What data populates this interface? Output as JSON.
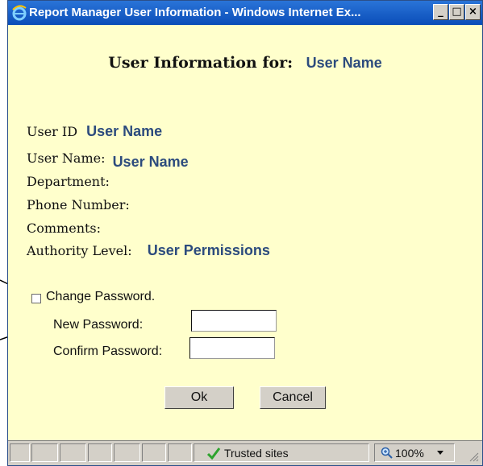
{
  "window": {
    "title": "Report Manager User Information - Windows Internet Ex...",
    "controls": {
      "minimize": "_",
      "maximize": "□",
      "close": "×"
    }
  },
  "heading": {
    "label": "User Information for:",
    "value": "User Name"
  },
  "fields": [
    {
      "label": "User ID",
      "value": "User Name"
    },
    {
      "label": "User Name:",
      "value": "User Name"
    },
    {
      "label": "Department:",
      "value": ""
    },
    {
      "label": "Phone Number:",
      "value": ""
    },
    {
      "label": "Comments:",
      "value": ""
    },
    {
      "label": "Authority Level:",
      "value": "User Permissions"
    }
  ],
  "password": {
    "change_label": "Change Password.",
    "change_checked": false,
    "new_label": "New Password:",
    "new_value": "",
    "confirm_label": "Confirm Password:",
    "confirm_value": ""
  },
  "buttons": {
    "ok": "Ok",
    "cancel": "Cancel"
  },
  "statusbar": {
    "zone": "Trusted sites",
    "zoom": "100%"
  },
  "colors": {
    "background": "#ffffcc",
    "value_text": "#2c4b7d",
    "titlebar": "#0a4db8"
  },
  "icons": [
    "ie-icon",
    "trusted-sites-check-icon",
    "zoom-icon",
    "dropdown-arrow-icon",
    "resize-grip-icon"
  ]
}
